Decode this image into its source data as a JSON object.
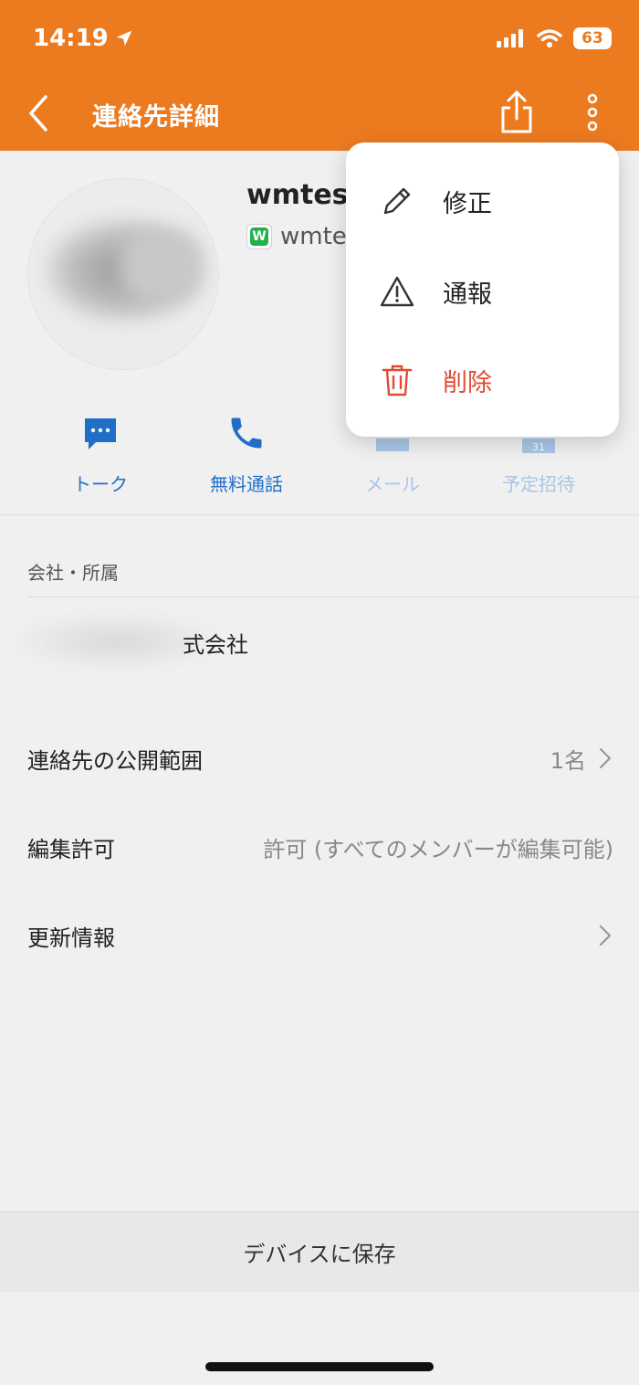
{
  "status_bar": {
    "time": "14:19",
    "battery": "63"
  },
  "header": {
    "title": "連絡先詳細"
  },
  "contact": {
    "name": "wmtest",
    "sub": "wmtest"
  },
  "actions": [
    {
      "label": "トーク",
      "icon": "chat-bubble-icon",
      "enabled": true
    },
    {
      "label": "無料通話",
      "icon": "phone-icon",
      "enabled": true
    },
    {
      "label": "メール",
      "icon": "mail-icon",
      "enabled": false
    },
    {
      "label": "予定招待",
      "icon": "calendar-icon",
      "enabled": false
    }
  ],
  "company": {
    "label": "会社・所属",
    "value": "式会社"
  },
  "rows": {
    "visibility": {
      "label": "連絡先の公開範囲",
      "value": "1名"
    },
    "edit_permission": {
      "label": "編集許可",
      "value": "許可 (すべてのメンバーが編集可能)"
    },
    "update_info": {
      "label": "更新情報"
    }
  },
  "save_button": "デバイスに保存",
  "menu": {
    "edit": "修正",
    "report": "通報",
    "delete": "削除"
  },
  "colors": {
    "accent": "#ec7b20",
    "link": "#1f6fc9",
    "danger": "#e24a33"
  }
}
